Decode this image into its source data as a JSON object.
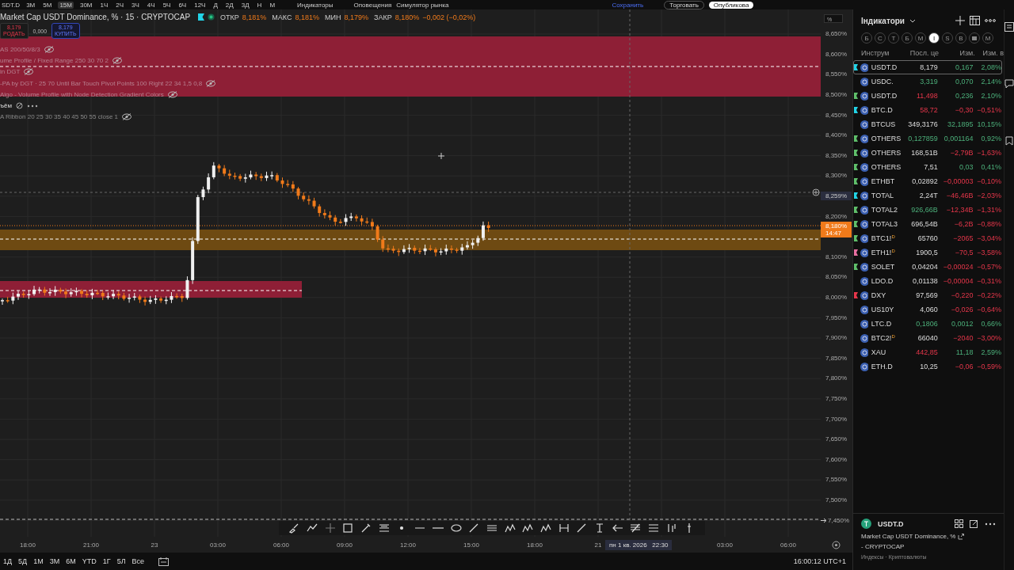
{
  "top_bar": {
    "symbol": "SDT.D",
    "timeframes": [
      {
        "label": "3М",
        "selected": false
      },
      {
        "label": "5М",
        "selected": false
      },
      {
        "label": "15М",
        "selected": true
      },
      {
        "label": "30М",
        "selected": false
      },
      {
        "label": "1Ч",
        "selected": false
      },
      {
        "label": "2Ч",
        "selected": false
      },
      {
        "label": "3Ч",
        "selected": false
      },
      {
        "label": "4Ч",
        "selected": false
      },
      {
        "label": "5Ч",
        "selected": false
      },
      {
        "label": "6Ч",
        "selected": false
      },
      {
        "label": "12Ч",
        "selected": false
      },
      {
        "label": "Д",
        "selected": false
      },
      {
        "label": "2Д",
        "selected": false
      },
      {
        "label": "3Д",
        "selected": false
      },
      {
        "label": "Н",
        "selected": false
      },
      {
        "label": "М",
        "selected": false
      }
    ],
    "indicators": "Индикаторы",
    "alerts": "Оповещения",
    "replay": "Симулятор рынка",
    "save": "Сохранить",
    "trade": "Торговать",
    "publish": "Опубликова"
  },
  "legend": {
    "title": "Market Cap USDT Dominance, % · 15 · CRYPTOCAP",
    "stats": [
      {
        "label": "ОТКР",
        "value": "8,181%"
      },
      {
        "label": "МАКС",
        "value": "8,181%"
      },
      {
        "label": "МИН",
        "value": "8,179%"
      },
      {
        "label": "ЗАКР",
        "value": "8,180%"
      }
    ],
    "change": "−0,002 (−0,02%)",
    "sell": {
      "price": "8,179",
      "label": "РОДАТЬ"
    },
    "spread": "0,000",
    "buy": {
      "price": "8,179",
      "label": "КУПИТЬ"
    },
    "indicators": [
      {
        "kind": "hidden",
        "text": "AS 200/50/8/3"
      },
      {
        "kind": "hidden",
        "text": "ume Profile / Fixed Range 250 30 70 2"
      },
      {
        "kind": "hidden",
        "text": "in DGT"
      },
      {
        "kind": "hidden",
        "text": "-PA by DGT · 25 70 Until Bar Touch Pivot Points 100 Right 22 34 1,5 0,8"
      },
      {
        "kind": "hidden",
        "text": "Algo - Volume Profile with Node Detection Gradient Colors"
      },
      {
        "kind": "volume",
        "text": "ъём"
      },
      {
        "kind": "hidden",
        "text": "A Ribbon 20 25 30 35 40 45 50 55 close 1"
      }
    ]
  },
  "price_axis": {
    "unit": "%",
    "labels": [
      {
        "kind": "tick",
        "text": "8,650%"
      },
      {
        "kind": "tick",
        "text": "8,600%"
      },
      {
        "kind": "tick",
        "text": "8,550%"
      },
      {
        "kind": "tick",
        "text": "8,500%"
      },
      {
        "kind": "tick",
        "text": "8,450%"
      },
      {
        "kind": "tick",
        "text": "8,400%"
      },
      {
        "kind": "tick",
        "text": "8,350%"
      },
      {
        "kind": "tick",
        "text": "8,300%"
      },
      {
        "kind": "crosshair",
        "text": "8,259%"
      },
      {
        "kind": "tick",
        "text": "8,200%"
      },
      {
        "kind": "last",
        "text": "8,180%",
        "time": "14:47"
      },
      {
        "kind": "tick",
        "text": "8,100%"
      },
      {
        "kind": "tick",
        "text": "8,050%"
      },
      {
        "kind": "tick",
        "text": "8,000%"
      },
      {
        "kind": "tick",
        "text": "7,950%"
      },
      {
        "kind": "tick",
        "text": "7,900%"
      },
      {
        "kind": "tick",
        "text": "7,850%"
      },
      {
        "kind": "tick",
        "text": "7,800%"
      },
      {
        "kind": "tick",
        "text": "7,750%"
      },
      {
        "kind": "tick",
        "text": "7,700%"
      },
      {
        "kind": "tick",
        "text": "7,650%"
      },
      {
        "kind": "tick",
        "text": "7,600%"
      },
      {
        "kind": "tick",
        "text": "7,550%"
      },
      {
        "kind": "tick",
        "text": "7,500%"
      },
      {
        "kind": "arrow",
        "text": "7,450%"
      }
    ]
  },
  "time_axis": {
    "labels": [
      "18:00",
      "21:00",
      "23",
      "03:00",
      "06:00",
      "09:00",
      "12:00",
      "15:00",
      "18:00",
      "21"
    ],
    "crosshair_date": "пн 1 кв. 2026",
    "crosshair_time": "22:30",
    "after": [
      "03:00",
      "06:00"
    ]
  },
  "bottom_bar": {
    "ranges": [
      "1Д",
      "5Д",
      "1М",
      "3М",
      "6М",
      "YTD",
      "1Г",
      "5Л",
      "Все"
    ],
    "clock": "16:00:12 UTC+1"
  },
  "watchlist": {
    "title": "Індикатори",
    "filters": [
      {
        "kind": "letter",
        "label": "Б",
        "selected": false
      },
      {
        "kind": "letter",
        "label": "С",
        "selected": false
      },
      {
        "kind": "letter",
        "label": "Т",
        "selected": false
      },
      {
        "kind": "letter",
        "label": "Б",
        "selected": false
      },
      {
        "kind": "letter",
        "label": "М",
        "selected": false
      },
      {
        "kind": "letter",
        "label": "I",
        "selected": true
      },
      {
        "kind": "letter",
        "label": "S",
        "selected": false
      },
      {
        "kind": "letter",
        "label": "B",
        "selected": false
      },
      {
        "kind": "icon",
        "selected": false
      },
      {
        "kind": "letter",
        "label": "M",
        "selected": false
      }
    ],
    "columns": [
      "Инструм",
      "Посл. це",
      "Изм.",
      "Изм. в"
    ],
    "rows": [
      {
        "symbol": "USDT.D",
        "last": "8,179",
        "last_up": false,
        "last_down": false,
        "change": "0,167",
        "change_pct": "2,08%",
        "down": false,
        "color": "#22d3e6",
        "selected": true
      },
      {
        "symbol": "USDC.",
        "last": "3,319",
        "last_up": true,
        "last_down": false,
        "change": "0,070",
        "change_pct": "2,14%",
        "down": false,
        "selected": false
      },
      {
        "symbol": "USDT.D",
        "last": "11,498",
        "last_up": false,
        "last_down": true,
        "change": "0,236",
        "change_pct": "2,10%",
        "down": false,
        "color": "#5fbf6a",
        "selected": false
      },
      {
        "symbol": "BTC.D",
        "last": "58,72",
        "last_up": false,
        "last_down": true,
        "change": "−0,30",
        "change_pct": "−0,51%",
        "down": true,
        "color": "#22d3e6",
        "selected": false
      },
      {
        "symbol": "BTCUS",
        "last": "349,3176",
        "last_up": false,
        "last_down": false,
        "change": "32,1895",
        "change_pct": "10,15%",
        "down": false,
        "selected": false
      },
      {
        "symbol": "OTHERS",
        "last": "0,127859",
        "last_up": true,
        "last_down": false,
        "change": "0,001164",
        "change_pct": "0,92%",
        "down": false,
        "color": "#5fbf6a",
        "selected": false
      },
      {
        "symbol": "OTHERS",
        "last": "168,51B",
        "last_up": false,
        "last_down": false,
        "change": "−2,79B",
        "change_pct": "−1,63%",
        "down": true,
        "color": "#5fbf6a",
        "selected": false
      },
      {
        "symbol": "OTHERS",
        "last": "7,51",
        "last_up": false,
        "last_down": false,
        "change": "0,03",
        "change_pct": "0,41%",
        "down": false,
        "color": "#5fbf6a",
        "selected": false
      },
      {
        "symbol": "ETHBT",
        "last": "0,02892",
        "last_up": false,
        "last_down": false,
        "change": "−0,00003",
        "change_pct": "−0,10%",
        "down": true,
        "color": "#5fbf6a",
        "selected": false
      },
      {
        "symbol": "TOTAL",
        "last": "2,24T",
        "last_up": false,
        "last_down": false,
        "change": "−46,46B",
        "change_pct": "−2,03%",
        "down": true,
        "color": "#22d3e6",
        "selected": false
      },
      {
        "symbol": "TOTAL2",
        "last": "926,66B",
        "last_up": true,
        "last_down": false,
        "change": "−12,34B",
        "change_pct": "−1,31%",
        "down": true,
        "color": "#5fbf6a",
        "selected": false
      },
      {
        "symbol": "TOTAL3",
        "last": "696,54B",
        "last_up": false,
        "last_down": false,
        "change": "−6,2B",
        "change_pct": "−0,88%",
        "down": true,
        "color": "#5fbf6a",
        "selected": false
      },
      {
        "symbol": "BTC1!",
        "badge": "D",
        "last": "65760",
        "last_up": false,
        "last_down": false,
        "change": "−2065",
        "change_pct": "−3,04%",
        "down": true,
        "color": "#5fbf6a",
        "selected": false
      },
      {
        "symbol": "ETH1!",
        "badge": "D",
        "last": "1900,5",
        "last_up": false,
        "last_down": false,
        "change": "−70,5",
        "change_pct": "−3,58%",
        "down": true,
        "color": "#e86fa0",
        "selected": false
      },
      {
        "symbol": "SOLET",
        "last": "0,04204",
        "last_up": false,
        "last_down": false,
        "change": "−0,00024",
        "change_pct": "−0,57%",
        "down": true,
        "color": "#5fbf6a",
        "selected": false
      },
      {
        "symbol": "LDO.D",
        "last": "0,01138",
        "last_up": false,
        "last_down": false,
        "change": "−0,00004",
        "change_pct": "−0,31%",
        "down": true,
        "selected": false
      },
      {
        "symbol": "DXY",
        "last": "97,569",
        "last_up": false,
        "last_down": false,
        "change": "−0,220",
        "change_pct": "−0,22%",
        "down": true,
        "color": "#e5364a",
        "selected": false
      },
      {
        "symbol": "US10Y",
        "last": "4,060",
        "last_up": false,
        "last_down": false,
        "change": "−0,026",
        "change_pct": "−0,64%",
        "down": true,
        "selected": false
      },
      {
        "symbol": "LTC.D",
        "last": "0,1806",
        "last_up": true,
        "last_down": false,
        "change": "0,0012",
        "change_pct": "0,66%",
        "down": false,
        "selected": false
      },
      {
        "symbol": "BTC2!",
        "badge": "D",
        "last": "66040",
        "last_up": false,
        "last_down": false,
        "change": "−2040",
        "change_pct": "−3,00%",
        "down": true,
        "selected": false
      },
      {
        "symbol": "XAU",
        "last": "442,85",
        "last_up": false,
        "last_down": true,
        "change": "11,18",
        "change_pct": "2,59%",
        "down": false,
        "selected": false
      },
      {
        "symbol": "ETH.D",
        "last": "10,25",
        "last_up": false,
        "last_down": false,
        "change": "−0,06",
        "change_pct": "−0,59%",
        "down": true,
        "selected": false
      }
    ]
  },
  "details": {
    "symbol": "USDT.D",
    "description": "Market Cap USDT Dominance, %",
    "exchange": "- CRYPTOCAP",
    "category": "Индексы · Криптовалюты"
  }
}
